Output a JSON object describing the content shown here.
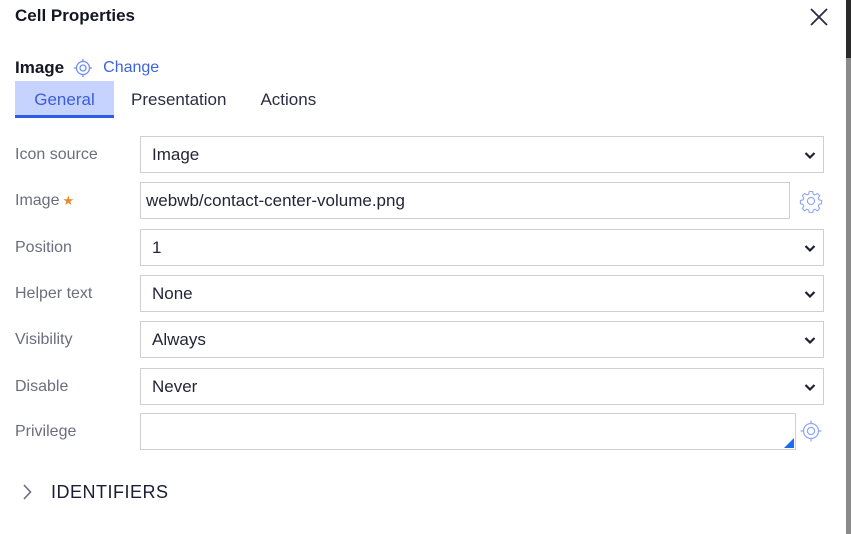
{
  "header": {
    "title": "Cell Properties",
    "close_icon": "close-icon"
  },
  "control": {
    "type_label": "Image",
    "type_icon": "target-icon",
    "change_label": "Change"
  },
  "tabs": [
    {
      "label": "General",
      "active": true
    },
    {
      "label": "Presentation",
      "active": false
    },
    {
      "label": "Actions",
      "active": false
    }
  ],
  "fields": {
    "icon_source": {
      "label": "Icon source",
      "value": "Image"
    },
    "image": {
      "label": "Image",
      "required_marker": "★",
      "value": "webwb/contact-center-volume.png",
      "side_icon": "gear-icon"
    },
    "position": {
      "label": "Position",
      "value": "1"
    },
    "helper_text": {
      "label": "Helper text",
      "value": "None"
    },
    "visibility": {
      "label": "Visibility",
      "value": "Always"
    },
    "disable": {
      "label": "Disable",
      "value": "Never"
    },
    "privilege": {
      "label": "Privilege",
      "value": "",
      "side_icon": "target-icon"
    }
  },
  "sections": {
    "identifiers": {
      "label": "IDENTIFIERS",
      "expanded": false
    }
  },
  "colors": {
    "accent": "#3c63e0",
    "tab_active_bg": "#c6d3ff",
    "tab_underline": "#2d5ce8",
    "required": "#e8892c"
  }
}
